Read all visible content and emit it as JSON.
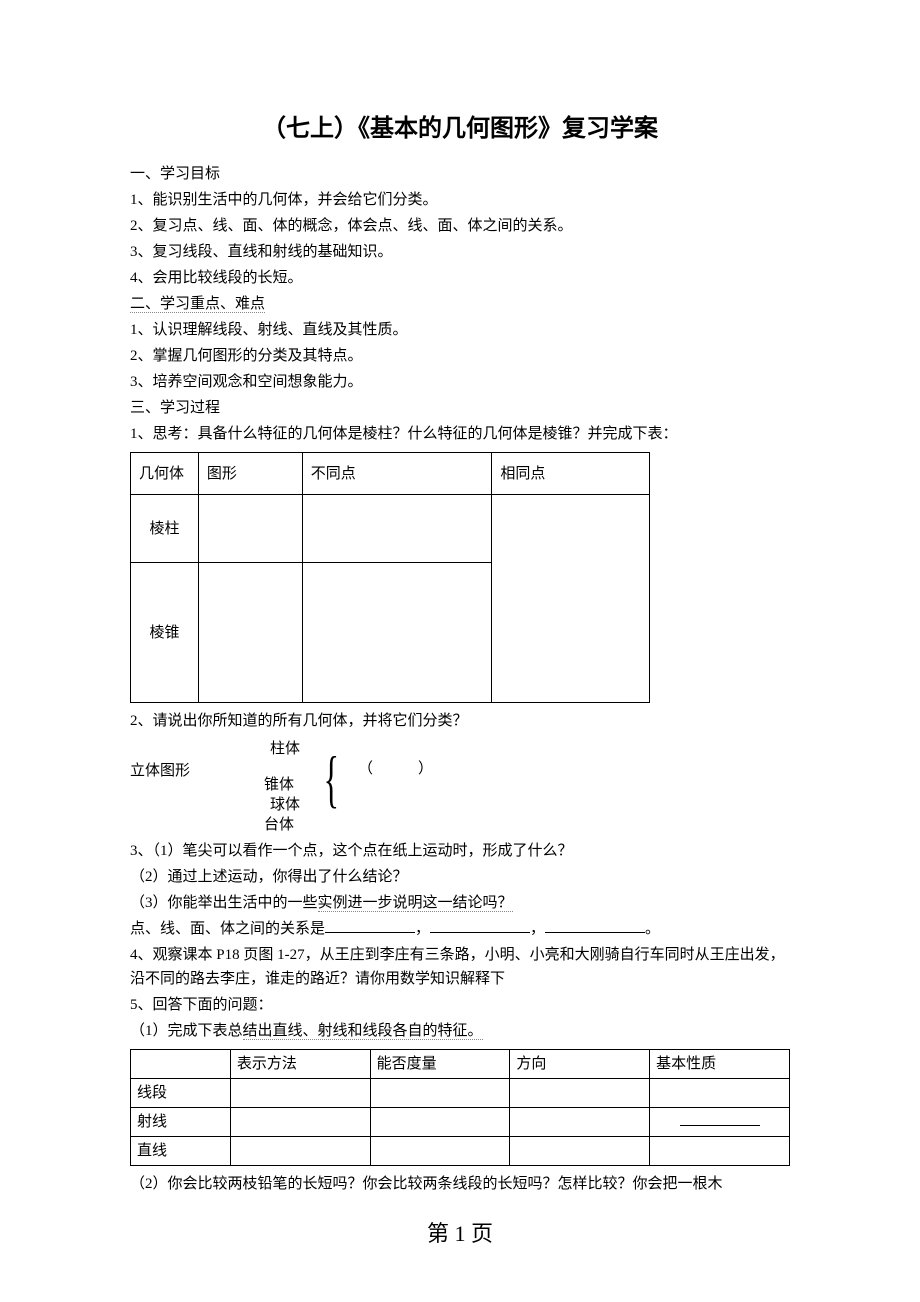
{
  "title": "（七上）《基本的几何图形》复习学案",
  "s1h": "一、学习目标",
  "s1": {
    "i1": "1、能识别生活中的几何体，并会给它们分类。",
    "i2": "2、复习点、线、面、体的概念，体会点、线、面、体之间的关系。",
    "i3": "3、复习线段、直线和射线的基础知识。",
    "i4": "4、会用比较线段的长短。"
  },
  "s2h": "二、学习重点、难点",
  "s2": {
    "i1": "1、认识理解线段、射线、直线及其性质。",
    "i2": "2、掌握几何图形的分类及其特点。",
    "i3": "3、培养空间观念和空间想象能力。"
  },
  "s3h": "三、学习过程",
  "q1": "1、思考：具备什么特征的几何体是棱柱？什么特征的几何体是棱锥？并完成下表：",
  "t1": {
    "h0": "几何体",
    "h1": "图形",
    "h2": "不同点",
    "h3": "相同点",
    "r1": "棱柱",
    "r2": "棱锥"
  },
  "q2": "2、请说出你所知道的所有几何体，并将它们分类？",
  "diag": {
    "root": "立体图形",
    "a": "柱体",
    "b": "锥体",
    "c": "球体",
    "d": "台体",
    "blank": "（　　　）"
  },
  "q3": {
    "a": "3、（1）笔尖可以看作一个点，这个点在纸上运动时，形成了什么？",
    "b": "（2）通过上述运动，你得出了什么结论？",
    "c_pre": "（3）你能举出生活中的一些",
    "c_mid": "实例进一步说",
    "c_mid2": "明这一结论吗？",
    "d_pre": "点、线、面、体之间的关系是",
    "d_sep": "，",
    "d_end": "。"
  },
  "q4": "4、观察课本 P18 页图 1-27，从王庄到李庄有三条路，小明、小亮和大刚骑自行车同时从王庄出发，沿不同的路去李庄，谁走的路近？请你用数学知识解释下",
  "q5": {
    "h": "5、回答下面的问题：",
    "a_pre": "（1）完成下表总",
    "a_mid": "结出直线、射线和线段各自的特征。"
  },
  "t2": {
    "h1": "表示方法",
    "h2": "能否度量",
    "h3": "方向",
    "h4": "基本性质",
    "r1": "线段",
    "r2": "射线",
    "r3": "直线"
  },
  "q5b": "（2）你会比较两枝铅笔的长短吗？你会比较两条线段的长短吗？怎样比较？你会把一根木",
  "footer": "第 1 页"
}
